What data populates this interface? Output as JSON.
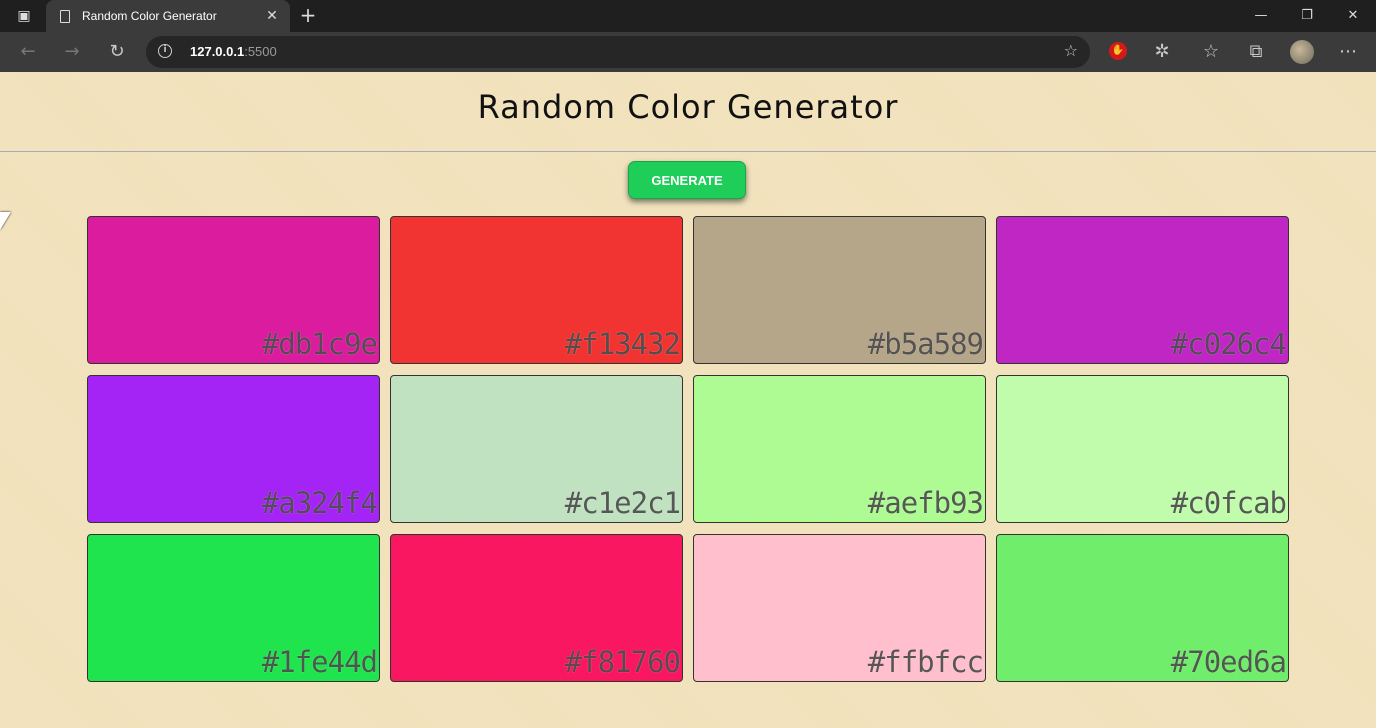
{
  "browser": {
    "tab_title": "Random Color Generator",
    "url_host": "127.0.0.1",
    "url_port": ":5500"
  },
  "page": {
    "title": "Random Color Generator",
    "generate_label": "GENERATE"
  },
  "swatches": [
    {
      "hex": "#db1c9e"
    },
    {
      "hex": "#f13432"
    },
    {
      "hex": "#b5a589"
    },
    {
      "hex": "#c026c4"
    },
    {
      "hex": "#a324f4"
    },
    {
      "hex": "#c1e2c1"
    },
    {
      "hex": "#aefb93"
    },
    {
      "hex": "#c0fcab"
    },
    {
      "hex": "#1fe44d"
    },
    {
      "hex": "#f81760"
    },
    {
      "hex": "#ffbfcc"
    },
    {
      "hex": "#70ed6a"
    }
  ],
  "colors": {
    "titlebar": "#1f1f1f",
    "toolbar": "#3b3b3b",
    "page_bg": "#f1e2bc",
    "button": "#1fce58"
  }
}
